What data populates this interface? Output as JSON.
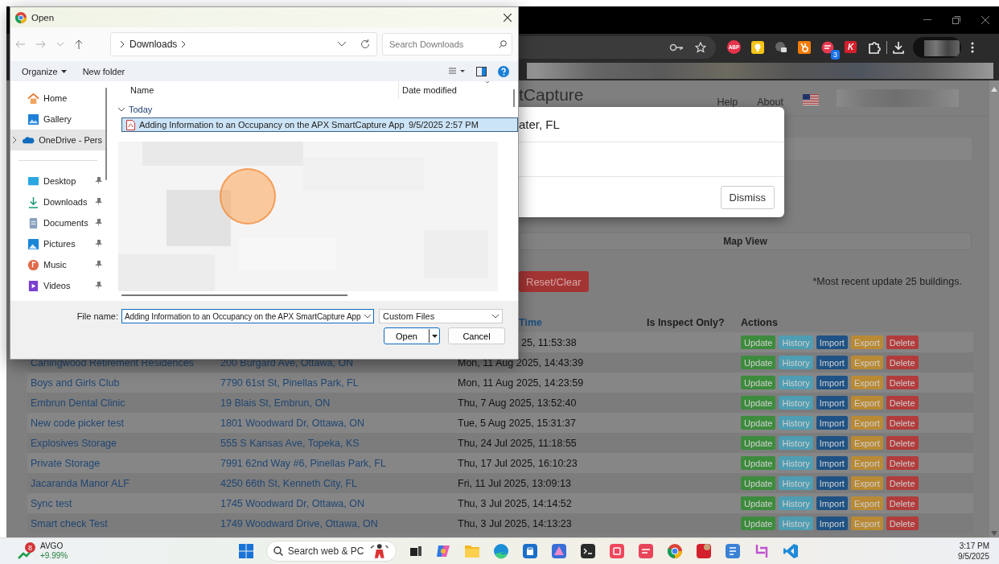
{
  "dialog": {
    "title": "Open",
    "breadcrumb": [
      "Downloads"
    ],
    "search_placeholder": "Search Downloads",
    "commands": [
      "Organize",
      "New folder"
    ],
    "nav_items": [
      {
        "label": "Home",
        "kind": "home",
        "pinned": false,
        "selected": false
      },
      {
        "label": "Gallery",
        "kind": "gallery",
        "pinned": false,
        "selected": false
      },
      {
        "label": "OneDrive - Pers",
        "kind": "cloud",
        "pinned": false,
        "selected": true
      },
      {
        "label": "Desktop",
        "kind": "desktop",
        "pinned": true,
        "selected": false
      },
      {
        "label": "Downloads",
        "kind": "download",
        "pinned": true,
        "selected": false
      },
      {
        "label": "Documents",
        "kind": "documents",
        "pinned": true,
        "selected": false
      },
      {
        "label": "Pictures",
        "kind": "pictures",
        "pinned": true,
        "selected": false
      },
      {
        "label": "Music",
        "kind": "music",
        "pinned": true,
        "selected": false
      },
      {
        "label": "Videos",
        "kind": "videos",
        "pinned": true,
        "selected": false
      }
    ],
    "columns": [
      "Name",
      "Date modified"
    ],
    "groups": [
      {
        "label": "Today",
        "expanded": true,
        "files": [
          {
            "name": "Adding Information to an Occupancy on the APX SmartCapture App",
            "date": "9/5/2025 2:57 PM",
            "selected": true
          }
        ]
      }
    ],
    "file_name_label": "File name:",
    "file_name": "Adding Information to an Occupancy on the APX SmartCapture App",
    "file_type": "Custom Files",
    "buttons": [
      "Open",
      "Cancel"
    ]
  },
  "browser": {
    "extensions": [
      {
        "kind": "adblock",
        "label": "ABP"
      },
      {
        "kind": "bulb"
      },
      {
        "kind": "tabs"
      },
      {
        "kind": "sprocket"
      },
      {
        "kind": "counter",
        "badge": "3"
      },
      {
        "kind": "letter",
        "label": "K"
      },
      {
        "kind": "puzzle"
      }
    ]
  },
  "page": {
    "title": "tCapture",
    "links": [
      "Help",
      "About"
    ],
    "modal": {
      "title": "ater, FL",
      "button": "Dismiss"
    },
    "map_view": "Map View",
    "reset_button": "Reset/Clear",
    "note": "*Most recent update 25 buildings.",
    "table": {
      "columns": [
        {
          "label": "Time",
          "kind": "link"
        },
        {
          "label": "Is Inspect Only?",
          "kind": "plain"
        },
        {
          "label": "Actions",
          "kind": "plain"
        }
      ],
      "rows": [
        {
          "time": "25, 11:53:38",
          "actions": [
            {
              "label": "Update",
              "color": "#3d8b3d"
            },
            {
              "label": "History",
              "color": "#4f9db2"
            },
            {
              "label": "Import",
              "color": "#1f5284"
            },
            {
              "label": "Export",
              "color": "#b98a35"
            },
            {
              "label": "Delete",
              "color": "#b23c3c"
            }
          ]
        },
        {
          "name": "Carlingwood Retirement Residences",
          "address": "200 Burgard Ave, Ottawa, ON",
          "time": "Mon, 11 Aug 2025, 14:43:39",
          "actions": [
            {
              "label": "Update",
              "color": "#3d8b3d"
            },
            {
              "label": "History",
              "color": "#4f9db2"
            },
            {
              "label": "Import",
              "color": "#1f5284"
            },
            {
              "label": "Export",
              "color": "#b98a35"
            },
            {
              "label": "Delete",
              "color": "#b23c3c"
            }
          ]
        },
        {
          "name": "Boys and Girls Club",
          "address": "7790 61st St, Pinellas Park, FL",
          "time": "Mon, 11 Aug 2025, 14:23:59",
          "actions": [
            {
              "label": "Update",
              "color": "#3d8b3d"
            },
            {
              "label": "History",
              "color": "#4f9db2"
            },
            {
              "label": "Import",
              "color": "#1f5284"
            },
            {
              "label": "Export",
              "color": "#b98a35"
            },
            {
              "label": "Delete",
              "color": "#b23c3c"
            }
          ]
        },
        {
          "name": "Embrun Dental Clinic",
          "address": "19 Blais St, Embrun, ON",
          "time": "Thu, 7 Aug 2025, 13:52:40",
          "actions": [
            {
              "label": "Update",
              "color": "#3d8b3d"
            },
            {
              "label": "History",
              "color": "#4f9db2"
            },
            {
              "label": "Import",
              "color": "#1f5284"
            },
            {
              "label": "Export",
              "color": "#b98a35"
            },
            {
              "label": "Delete",
              "color": "#b23c3c"
            }
          ]
        },
        {
          "name": "New code picker test",
          "address": "1801 Woodward Dr, Ottawa, ON",
          "time": "Tue, 5 Aug 2025, 15:31:37",
          "actions": [
            {
              "label": "Update",
              "color": "#3d8b3d"
            },
            {
              "label": "History",
              "color": "#4f9db2"
            },
            {
              "label": "Import",
              "color": "#1f5284"
            },
            {
              "label": "Export",
              "color": "#b98a35"
            },
            {
              "label": "Delete",
              "color": "#b23c3c"
            }
          ]
        },
        {
          "name": "Explosives Storage",
          "address": "555 S Kansas Ave, Topeka, KS",
          "time": "Thu, 24 Jul 2025, 11:18:55",
          "actions": [
            {
              "label": "Update",
              "color": "#3d8b3d"
            },
            {
              "label": "History",
              "color": "#4f9db2"
            },
            {
              "label": "Import",
              "color": "#1f5284"
            },
            {
              "label": "Export",
              "color": "#b98a35"
            },
            {
              "label": "Delete",
              "color": "#b23c3c"
            }
          ]
        },
        {
          "name": "Private Storage",
          "address": "7991 62nd Way #6, Pinellas Park, FL",
          "time": "Thu, 17 Jul 2025, 16:10:23",
          "actions": [
            {
              "label": "Update",
              "color": "#3d8b3d"
            },
            {
              "label": "History",
              "color": "#4f9db2"
            },
            {
              "label": "Import",
              "color": "#1f5284"
            },
            {
              "label": "Export",
              "color": "#b98a35"
            },
            {
              "label": "Delete",
              "color": "#b23c3c"
            }
          ]
        },
        {
          "name": "Jacaranda Manor ALF",
          "address": "4250 66th St, Kenneth City, FL",
          "time": "Fri, 11 Jul 2025, 13:09:13",
          "actions": [
            {
              "label": "Update",
              "color": "#3d8b3d"
            },
            {
              "label": "History",
              "color": "#4f9db2"
            },
            {
              "label": "Import",
              "color": "#1f5284"
            },
            {
              "label": "Export",
              "color": "#b98a35"
            },
            {
              "label": "Delete",
              "color": "#b23c3c"
            }
          ]
        },
        {
          "name": "Sync test",
          "address": "1745 Woodward Dr, Ottawa, ON",
          "time": "Thu, 3 Jul 2025, 14:14:52",
          "actions": [
            {
              "label": "Update",
              "color": "#3d8b3d"
            },
            {
              "label": "History",
              "color": "#4f9db2"
            },
            {
              "label": "Import",
              "color": "#1f5284"
            },
            {
              "label": "Export",
              "color": "#b98a35"
            },
            {
              "label": "Delete",
              "color": "#b23c3c"
            }
          ]
        },
        {
          "name": "Smart check Test",
          "address": "1749 Woodward Drive, Ottawa, ON",
          "time": "Thu, 3 Jul 2025, 14:13:23",
          "actions": [
            {
              "label": "Update",
              "color": "#3d8b3d"
            },
            {
              "label": "History",
              "color": "#4f9db2"
            },
            {
              "label": "Import",
              "color": "#1f5284"
            },
            {
              "label": "Export",
              "color": "#b98a35"
            },
            {
              "label": "Delete",
              "color": "#b23c3c"
            }
          ]
        }
      ]
    }
  },
  "taskbar": {
    "stock": {
      "badge": "8",
      "symbol": "AVGO",
      "change": "+9.99%"
    },
    "search_label": "Search web & PC",
    "clock": {
      "time": "3:17 PM",
      "date": "9/5/2025"
    }
  }
}
